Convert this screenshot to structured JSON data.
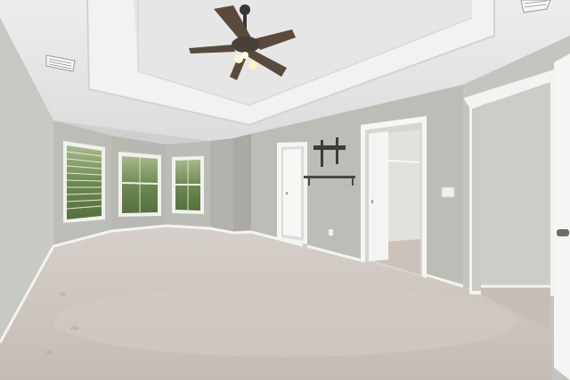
{
  "scene": {
    "description_label": "",
    "colors": {
      "ceiling": "#e9e9e9",
      "ceiling_shadow": "#d7d7d7",
      "tray": "#f1f1f1",
      "wall_left": "#c9c9c6",
      "wall_back": "#bfbfba",
      "wall_right": "#c6c6c2",
      "bay_wall": "#b9b9b4",
      "trim": "#f4f4f2",
      "carpet": "#cdc6bf",
      "carpet_dark": "#bdb5ad",
      "window_glass": "#6f8a55",
      "window_frame": "#f2f2f0",
      "door": "#f3f3f1",
      "fan_dark": "#3f3a36",
      "fan_light": "#fff6cf",
      "closet": "#d9d7d2"
    },
    "objects": [
      "ceiling-fan",
      "bay-window-left",
      "bay-window-center",
      "bay-window-right",
      "tv-wall-mount",
      "wall-shelf",
      "hall-door",
      "walk-in-closet",
      "bathroom-doorway",
      "air-vent-left",
      "air-vent-right",
      "light-switch",
      "wall-outlet"
    ]
  }
}
